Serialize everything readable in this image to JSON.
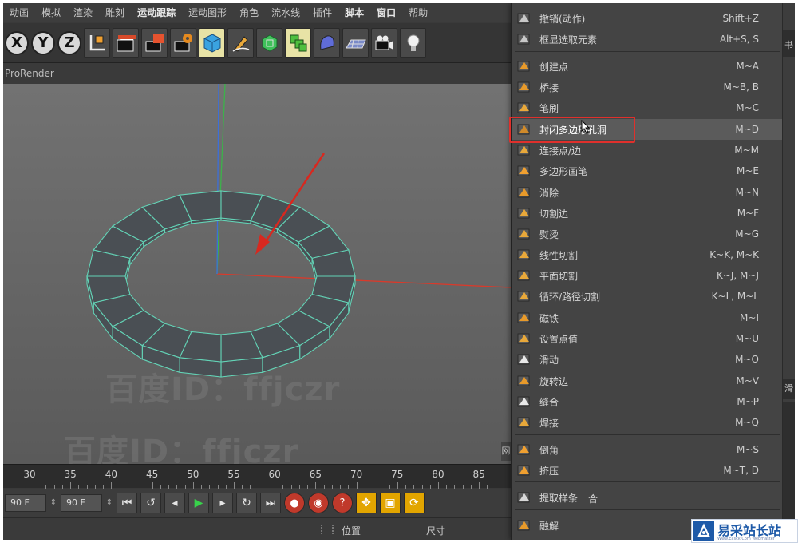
{
  "menubar": {
    "items": [
      "动画",
      "模拟",
      "渲染",
      "雕刻",
      "运动跟踪",
      "运动图形",
      "角色",
      "流水线",
      "插件",
      "脚本",
      "窗口",
      "帮助"
    ],
    "bold_items": [
      "运动跟踪",
      "脚本",
      "窗口"
    ]
  },
  "toolbar": {
    "axis_labels": [
      "X",
      "Y",
      "Z"
    ],
    "icons": [
      "x-axis-icon",
      "y-axis-icon",
      "z-axis-icon",
      "coordinate-system-icon",
      "render-view-icon",
      "render-picture-icon",
      "render-settings-icon",
      "cube-icon",
      "pen-icon",
      "subdivision-icon",
      "array-icon",
      "deformer-icon",
      "floor-icon",
      "camera-icon",
      "light-icon"
    ]
  },
  "viewport": {
    "label": "ProRender",
    "edge_label": "网",
    "watermarks": [
      "百度ID：ffjczr",
      "百度ID：ffjczr",
      "百度ID：ffjczr"
    ]
  },
  "timeline": {
    "ticks": [
      "30",
      "35",
      "40",
      "45",
      "50",
      "55",
      "60",
      "65",
      "70",
      "75",
      "80",
      "85"
    ]
  },
  "transport": {
    "start_frame": "90 F",
    "end_frame": "90 F"
  },
  "attributes": {
    "position_label": "位置",
    "size_label": "尺寸"
  },
  "context_menu": {
    "items": [
      {
        "label": "撤销(动作)",
        "shortcut": "Shift+Z",
        "icon": "undo-icon"
      },
      {
        "label": "框显选取元素",
        "shortcut": "Alt+S, S",
        "icon": "frame-selection-icon"
      },
      {
        "label": "创建点",
        "shortcut": "M~A",
        "icon": "create-point-icon"
      },
      {
        "label": "桥接",
        "shortcut": "M~B, B",
        "icon": "bridge-icon"
      },
      {
        "label": "笔刷",
        "shortcut": "M~C",
        "icon": "brush-icon"
      },
      {
        "label": "封闭多边形孔洞",
        "shortcut": "M~D",
        "icon": "close-polygon-hole-icon"
      },
      {
        "label": "连接点/边",
        "shortcut": "M~M",
        "icon": "connect-icon"
      },
      {
        "label": "多边形画笔",
        "shortcut": "M~E",
        "icon": "polygon-pen-icon"
      },
      {
        "label": "消除",
        "shortcut": "M~N",
        "icon": "dissolve-icon"
      },
      {
        "label": "切割边",
        "shortcut": "M~F",
        "icon": "edge-cut-icon"
      },
      {
        "label": "熨烫",
        "shortcut": "M~G",
        "icon": "iron-icon"
      },
      {
        "label": "线性切割",
        "shortcut": "K~K, M~K",
        "icon": "line-cut-icon"
      },
      {
        "label": "平面切割",
        "shortcut": "K~J, M~J",
        "icon": "plane-cut-icon"
      },
      {
        "label": "循环/路径切割",
        "shortcut": "K~L, M~L",
        "icon": "loop-cut-icon"
      },
      {
        "label": "磁铁",
        "shortcut": "M~I",
        "icon": "magnet-icon"
      },
      {
        "label": "设置点值",
        "shortcut": "M~U",
        "icon": "set-point-value-icon"
      },
      {
        "label": "滑动",
        "shortcut": "M~O",
        "icon": "slide-icon"
      },
      {
        "label": "旋转边",
        "shortcut": "M~V",
        "icon": "spin-edge-icon"
      },
      {
        "label": "缝合",
        "shortcut": "M~P",
        "icon": "stitch-icon"
      },
      {
        "label": "焊接",
        "shortcut": "M~Q",
        "icon": "weld-icon"
      },
      {
        "label": "倒角",
        "shortcut": "M~S",
        "icon": "bevel-icon"
      },
      {
        "label": "挤压",
        "shortcut": "M~T, D",
        "icon": "extrude-icon"
      },
      {
        "label": "提取样条",
        "shortcut": "",
        "icon": "extract-spline-icon"
      },
      {
        "label": "融解",
        "shortcut": "",
        "icon": "melt-icon"
      }
    ],
    "highlighted_index": 5,
    "partial_text": "合"
  },
  "right_panel": {
    "fragments": [
      "书",
      "滑"
    ]
  },
  "brand": {
    "name": "易采站长站",
    "sub": "Www.Easck.Com  Webmaster"
  },
  "colors": {
    "mesh_fill": "#4a4f54",
    "mesh_edge": "#63d3b6",
    "x_axis": "#d93a2b",
    "y_axis": "#3cb24a",
    "z_axis": "#3d6fd8",
    "arrow": "#d8281f",
    "highlight_box": "#e0302c",
    "brand_blue": "#1e5aa8"
  }
}
